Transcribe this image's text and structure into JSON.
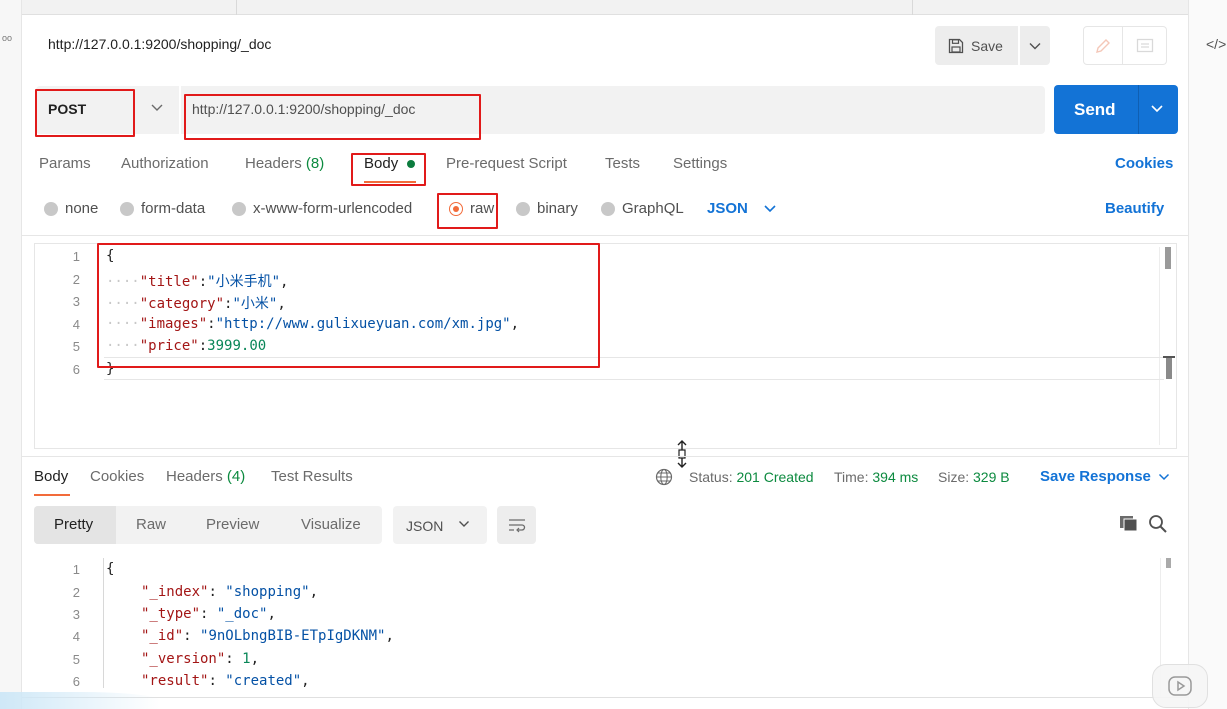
{
  "request": {
    "title": "http://127.0.0.1:9200/shopping/_doc",
    "method": "POST",
    "url": "http://127.0.0.1:9200/shopping/_doc",
    "save_label": "Save",
    "send_label": "Send"
  },
  "request_tabs": {
    "params": "Params",
    "authorization": "Authorization",
    "headers": "Headers",
    "headers_count": "(8)",
    "body": "Body",
    "prerequest": "Pre-request Script",
    "tests": "Tests",
    "settings": "Settings",
    "cookies": "Cookies"
  },
  "body_types": {
    "none": "none",
    "form_data": "form-data",
    "urlencoded": "x-www-form-urlencoded",
    "raw": "raw",
    "binary": "binary",
    "graphql": "GraphQL",
    "format": "JSON",
    "beautify": "Beautify",
    "selected": "raw"
  },
  "request_body": {
    "line_numbers": [
      "1",
      "2",
      "3",
      "4",
      "5",
      "6"
    ],
    "open_brace": "{",
    "close_brace": "}",
    "indent": "····",
    "fields": [
      {
        "key": "\"title\"",
        "sep": ":",
        "value": "\"小米手机\"",
        "trail": ","
      },
      {
        "key": "\"category\"",
        "sep": ":",
        "value": "\"小米\"",
        "trail": ","
      },
      {
        "key": "\"images\"",
        "sep": ":",
        "value": "\"http://www.gulixueyuan.com/xm.jpg\"",
        "trail": ","
      },
      {
        "key": "\"price\"",
        "sep": ":",
        "value": "3999.00",
        "trail": ""
      }
    ]
  },
  "response_tabs": {
    "body": "Body",
    "cookies": "Cookies",
    "headers": "Headers",
    "headers_count": "(4)",
    "test_results": "Test Results"
  },
  "response_meta": {
    "status_label": "Status:",
    "status_value": "201 Created",
    "time_label": "Time:",
    "time_value": "394 ms",
    "size_label": "Size:",
    "size_value": "329 B",
    "save_response": "Save Response"
  },
  "response_view": {
    "pretty": "Pretty",
    "raw": "Raw",
    "preview": "Preview",
    "visualize": "Visualize",
    "format": "JSON"
  },
  "response_body": {
    "line_numbers": [
      "1",
      "2",
      "3",
      "4",
      "5",
      "6"
    ],
    "open_brace": "{",
    "fields": [
      {
        "key": "\"_index\"",
        "sep": ": ",
        "value": "\"shopping\"",
        "trail": ","
      },
      {
        "key": "\"_type\"",
        "sep": ": ",
        "value": "\"_doc\"",
        "trail": ","
      },
      {
        "key": "\"_id\"",
        "sep": ": ",
        "value": "\"9nOLbngBIB-ETpIgDKNM\"",
        "trail": ","
      },
      {
        "key": "\"_version\"",
        "sep": ": ",
        "value": "1",
        "trail": ","
      },
      {
        "key": "\"result\"",
        "sep": ": ",
        "value": "\"created\"",
        "trail": ","
      }
    ]
  },
  "misc": {
    "code_toggle": "</>",
    "left_dots": "oo"
  },
  "colors": {
    "accent_orange": "#f26b3a",
    "send_blue": "#1373d6",
    "status_green": "#0c8a3f",
    "annotation_red": "#e11a1a"
  }
}
